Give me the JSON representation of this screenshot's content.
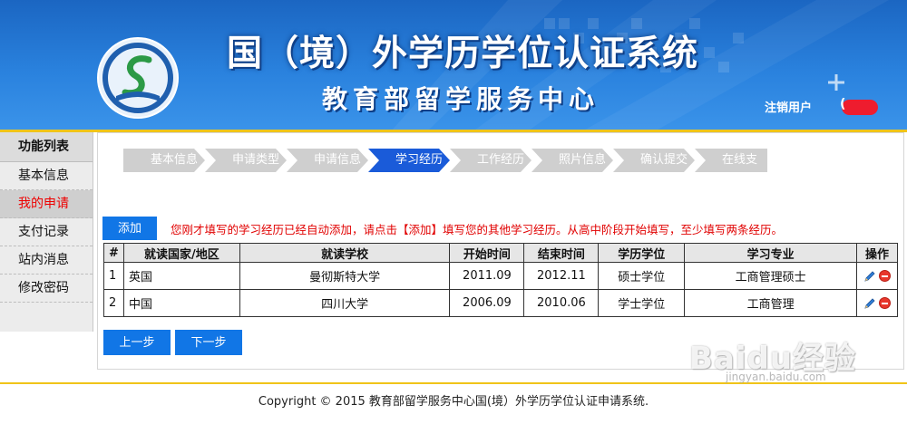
{
  "header": {
    "title": "国（境）外学历学位认证系统",
    "subtitle": "教育部留学服务中心",
    "logout_label": "注销用户",
    "user_paren": "("
  },
  "sidebar": {
    "title": "功能列表",
    "items": [
      {
        "label": "基本信息"
      },
      {
        "label": "我的申请"
      },
      {
        "label": "支付记录"
      },
      {
        "label": "站内消息"
      },
      {
        "label": "修改密码"
      }
    ]
  },
  "steps": [
    {
      "label": "基本信息"
    },
    {
      "label": "申请类型"
    },
    {
      "label": "申请信息"
    },
    {
      "label": "学习经历"
    },
    {
      "label": "工作经历"
    },
    {
      "label": "照片信息"
    },
    {
      "label": "确认提交"
    },
    {
      "label": "在线支付"
    }
  ],
  "actions": {
    "add_label": "添加",
    "notice": "您刚才填写的学习经历已经自动添加，请点击【添加】填写您的其他学习经历。从高中阶段开始填写，至少填写两条经历。",
    "prev_label": "上一步",
    "next_label": "下一步"
  },
  "table": {
    "headers": [
      "#",
      "就读国家/地区",
      "就读学校",
      "开始时间",
      "结束时间",
      "学历学位",
      "学习专业",
      "操作"
    ],
    "rows": [
      {
        "num": "1",
        "country": "英国",
        "school": "曼彻斯特大学",
        "start": "2011.09",
        "end": "2012.11",
        "degree": "硕士学位",
        "major": "工商管理硕士"
      },
      {
        "num": "2",
        "country": "中国",
        "school": "四川大学",
        "start": "2006.09",
        "end": "2010.06",
        "degree": "学士学位",
        "major": "工商管理"
      }
    ]
  },
  "footer": {
    "copyright": "Copyright © 2015 教育部留学服务中心国(境）外学历学位认证申请系统."
  },
  "watermark": {
    "main": "Baidu经验",
    "sub": "jingyan.baidu.com"
  },
  "colors": {
    "header_blue": "#2a82de",
    "accent_yellow": "#f0c419",
    "button_blue": "#1176e6",
    "active_step": "#1a5bd9",
    "notice_red": "#e10000"
  }
}
